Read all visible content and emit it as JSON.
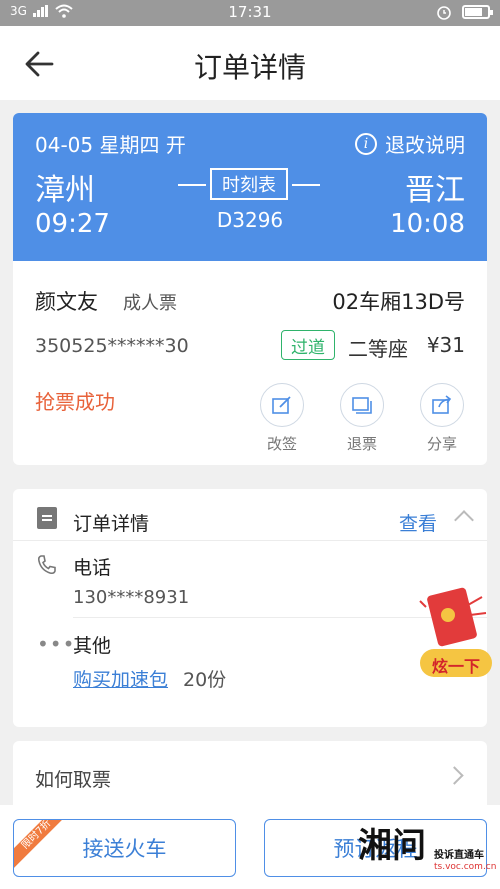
{
  "status_bar": {
    "network": "3G",
    "time": "17:31"
  },
  "nav": {
    "title": "订单详情"
  },
  "ticket": {
    "date": "04-05 星期四 开",
    "refund_info": "退改说明",
    "from_station": "漳州",
    "to_station": "晋江",
    "depart_time": "09:27",
    "arrive_time": "10:08",
    "timetable": "时刻表",
    "train_no": "D3296",
    "passenger_name": "颜文友",
    "ticket_type": "成人票",
    "seat": "02车厢13D号",
    "id_number": "350525******30",
    "check_status": "过道",
    "seat_class": "二等座",
    "price": "¥31",
    "order_status": "抢票成功",
    "actions": [
      {
        "label": "改签",
        "icon": "edit-icon"
      },
      {
        "label": "退票",
        "icon": "refund-icon"
      },
      {
        "label": "分享",
        "icon": "share-icon"
      }
    ]
  },
  "order_details": {
    "title": "订单详情",
    "view": "查看",
    "phone_label": "电话",
    "phone_value": "130****8931",
    "other_label": "其他",
    "buy_link": "购买加速包",
    "count": "20份"
  },
  "promo": {
    "text": "炫一下"
  },
  "howto": {
    "label": "如何取票"
  },
  "bottom": {
    "pickup_button": "接送火车",
    "pickup_ribbon": "限时7折",
    "return_button": "预订返程"
  },
  "watermark": {
    "big": "湘问",
    "sub": "投诉直通车",
    "url": "ts.voc.com.cn"
  },
  "colors": {
    "header_blue": "#4f8fe6",
    "link_blue": "#3b7fd6",
    "status_orange": "#e8623a",
    "pass_green": "#2fb36b"
  }
}
